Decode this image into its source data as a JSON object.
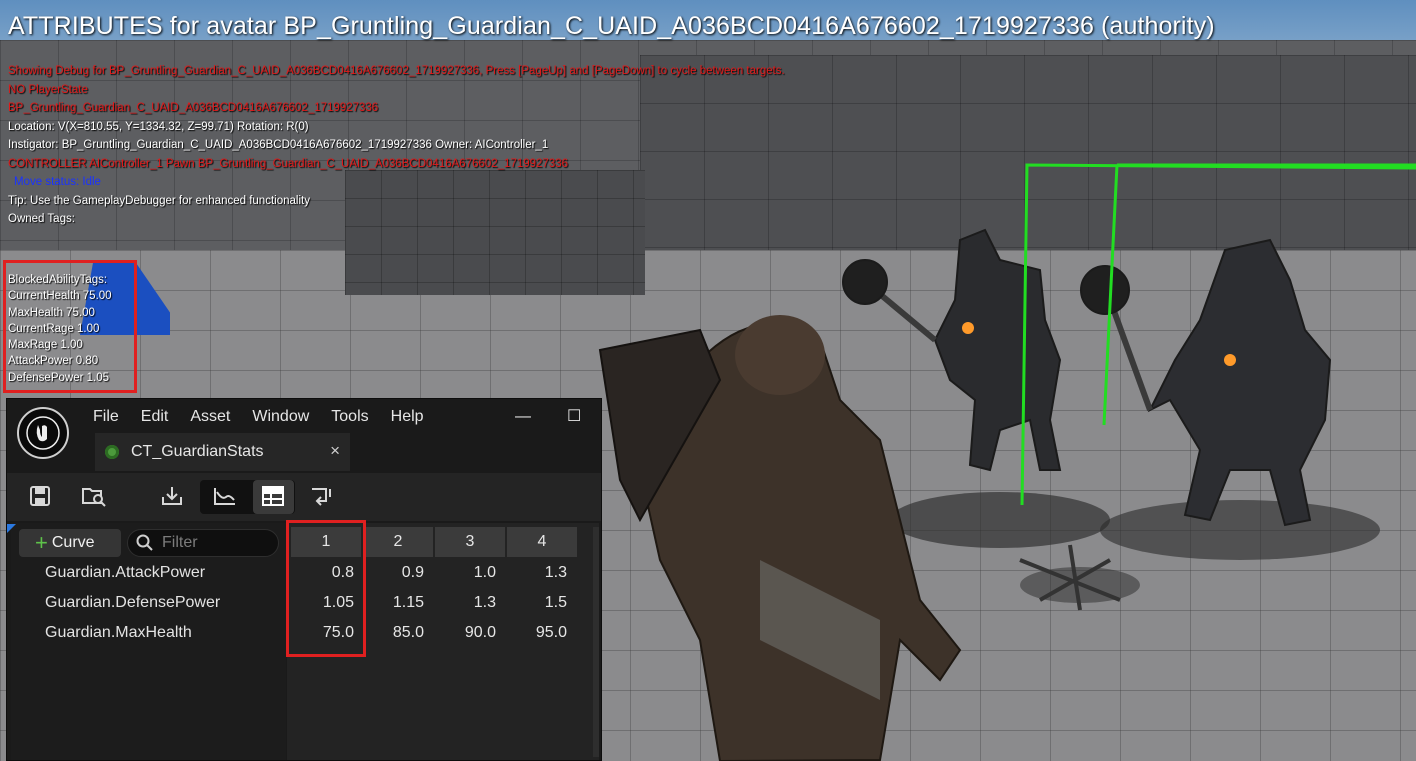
{
  "debug": {
    "title": "ATTRIBUTES for avatar BP_Gruntling_Guardian_C_UAID_A036BCD0416A676602_1719927336 (authority)",
    "lines": [
      {
        "text": "Showing Debug for BP_Gruntling_Guardian_C_UAID_A036BCD0416A676602_1719927336, Press [PageUp] and [PageDown] to cycle between targets.",
        "color": "red"
      },
      {
        "text": "NO PlayerState",
        "color": "red"
      },
      {
        "text": "BP_Gruntling_Guardian_C_UAID_A036BCD0416A676602_1719927336",
        "color": "red"
      },
      {
        "text": "Location: V(X=810.55, Y=1334.32, Z=99.71) Rotation: R(0)",
        "color": "white"
      },
      {
        "text": " Instigator: BP_Gruntling_Guardian_C_UAID_A036BCD0416A676602_1719927336 Owner: AIController_1",
        "color": "white"
      },
      {
        "text": "CONTROLLER AIController_1 Pawn BP_Gruntling_Guardian_C_UAID_A036BCD0416A676602_1719927336",
        "color": "red"
      },
      {
        "text": "Move status: Idle",
        "color": "blue"
      },
      {
        "text": "Tip: Use the GameplayDebugger for enhanced functionality",
        "color": "white"
      },
      {
        "text": "Owned Tags:",
        "color": "white"
      }
    ],
    "attributes": [
      "BlockedAbilityTags:",
      "CurrentHealth 75.00",
      "MaxHealth 75.00",
      "CurrentRage 1.00",
      "MaxRage 1.00",
      "AttackPower 0.80",
      "DefensePower 1.05"
    ]
  },
  "editor": {
    "menu": [
      "File",
      "Edit",
      "Asset",
      "Window",
      "Tools",
      "Help"
    ],
    "window_controls": {
      "minimize": "—",
      "maximize": "☐"
    },
    "tab": {
      "label": "CT_GuardianStats",
      "close": "×"
    },
    "add_curve_label": "Curve",
    "filter_placeholder": "Filter",
    "columns": [
      "1",
      "2",
      "3",
      "4"
    ],
    "rows": [
      {
        "name": "Guardian.AttackPower",
        "values": [
          "0.8",
          "0.9",
          "1.0",
          "1.3"
        ]
      },
      {
        "name": "Guardian.DefensePower",
        "values": [
          "1.05",
          "1.15",
          "1.3",
          "1.5"
        ]
      },
      {
        "name": "Guardian.MaxHealth",
        "values": [
          "75.0",
          "85.0",
          "90.0",
          "95.0"
        ]
      }
    ]
  },
  "colors": {
    "debug_red": "#e01a1a",
    "highlight_red": "#e02020",
    "debug_bounds_green": "#22dd22",
    "curve_green": "#5ec24a"
  }
}
